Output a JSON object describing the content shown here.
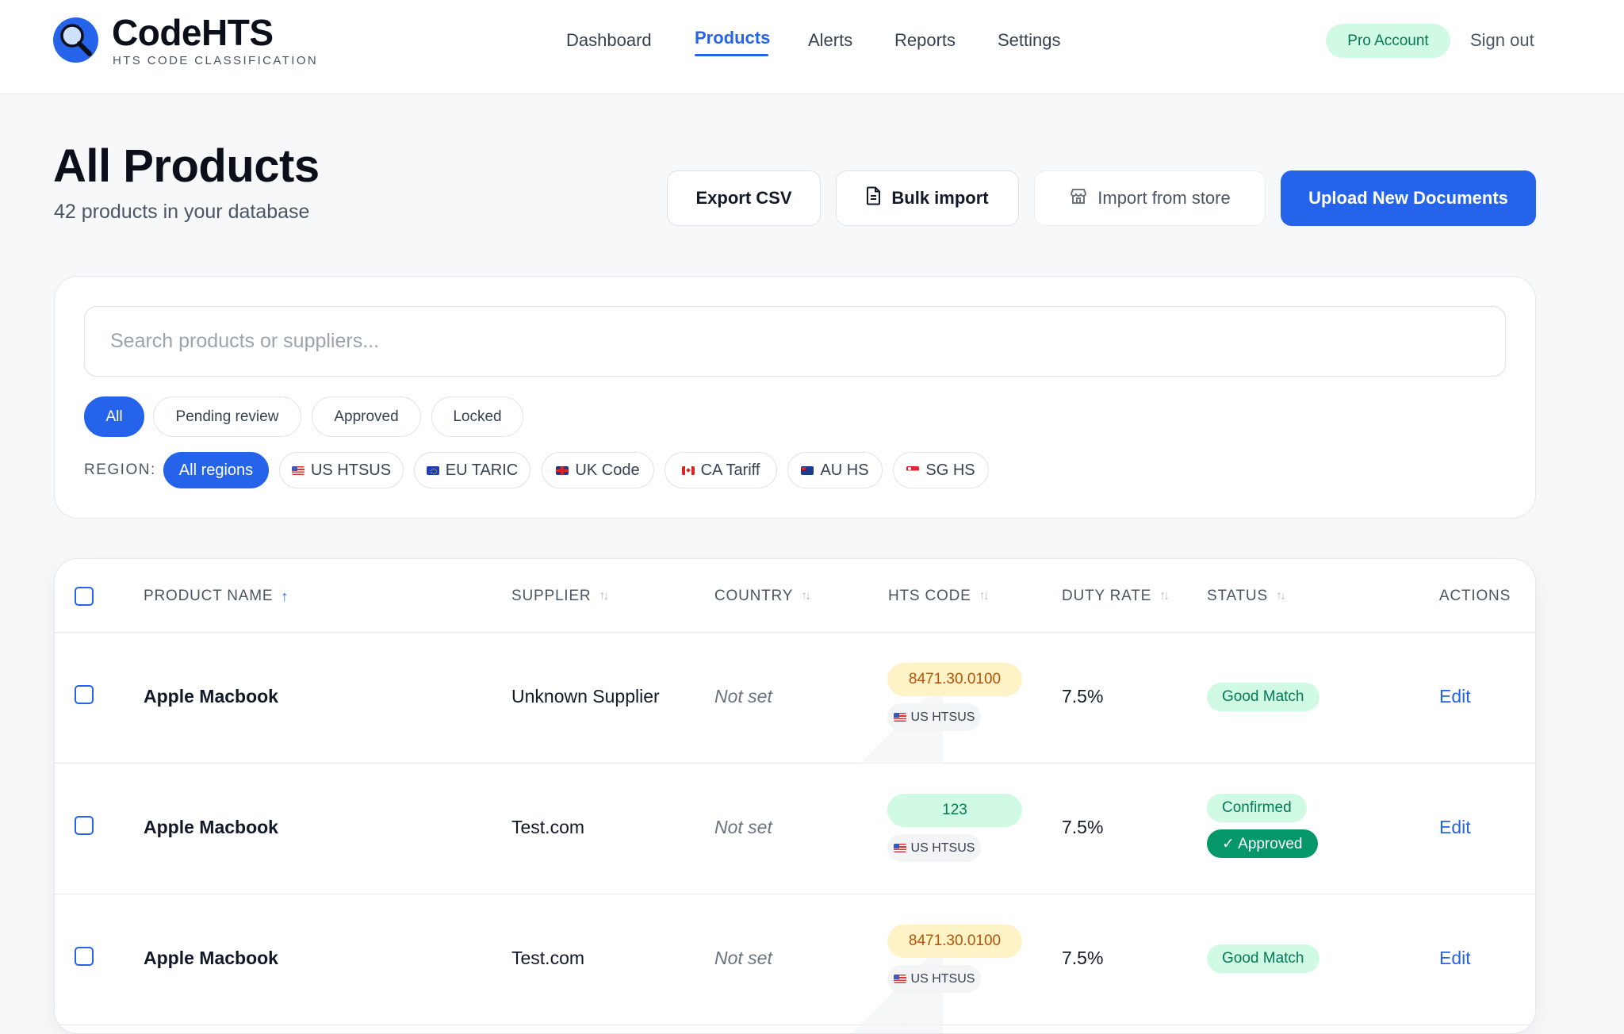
{
  "brand": {
    "name": "CodeHTS",
    "tagline": "HTS CODE CLASSIFICATION"
  },
  "nav": {
    "items": [
      {
        "label": "Dashboard",
        "active": false
      },
      {
        "label": "Products",
        "active": true
      },
      {
        "label": "Alerts",
        "active": false
      },
      {
        "label": "Reports",
        "active": false
      },
      {
        "label": "Settings",
        "active": false
      }
    ],
    "account_badge": "Pro Account",
    "sign_out": "Sign out"
  },
  "page": {
    "title": "All Products",
    "subtitle": "42 products in your database"
  },
  "actions": {
    "export": "Export CSV",
    "bulk_import": "Bulk import",
    "import_store": "Import from store",
    "upload": "Upload New Documents"
  },
  "filters": {
    "search_placeholder": "Search products or suppliers...",
    "status_chips": [
      "All",
      "Pending review",
      "Approved",
      "Locked"
    ],
    "status_selected": "All",
    "region_label": "REGION:",
    "region_chips": [
      {
        "label": "All regions",
        "flag": ""
      },
      {
        "label": "US HTSUS",
        "flag": "us"
      },
      {
        "label": "EU TARIC",
        "flag": "eu"
      },
      {
        "label": "UK Code",
        "flag": "uk"
      },
      {
        "label": "CA Tariff",
        "flag": "ca"
      },
      {
        "label": "AU HS",
        "flag": "au"
      },
      {
        "label": "SG HS",
        "flag": "sg"
      }
    ],
    "region_selected": "All regions"
  },
  "table": {
    "columns": [
      "PRODUCT NAME",
      "SUPPLIER",
      "COUNTRY",
      "HTS CODE",
      "DUTY RATE",
      "STATUS",
      "ACTIONS"
    ],
    "sorted_column": "PRODUCT NAME",
    "rows": [
      {
        "name": "Apple Macbook",
        "supplier": "Unknown Supplier",
        "country": "Not set",
        "hts_code": "8471.30.0100",
        "hts_style": "warn",
        "region": "US HTSUS",
        "duty": "7.5%",
        "status": "Good Match",
        "status2": "",
        "action": "Edit"
      },
      {
        "name": "Apple Macbook",
        "supplier": "Test.com",
        "country": "Not set",
        "hts_code": "123",
        "hts_style": "good",
        "region": "US HTSUS",
        "duty": "7.5%",
        "status": "Confirmed",
        "status2": "✓ Approved",
        "action": "Edit"
      },
      {
        "name": "Apple Macbook",
        "supplier": "Test.com",
        "country": "Not set",
        "hts_code": "8471.30.0100",
        "hts_style": "warn",
        "region": "US HTSUS",
        "duty": "7.5%",
        "status": "Good Match",
        "status2": "",
        "action": "Edit"
      }
    ]
  },
  "colors": {
    "accent": "#2563eb",
    "success": "#059669",
    "success_bg": "#d1fae5",
    "warn_bg": "#fef3c7",
    "warn_text": "#b45309"
  }
}
